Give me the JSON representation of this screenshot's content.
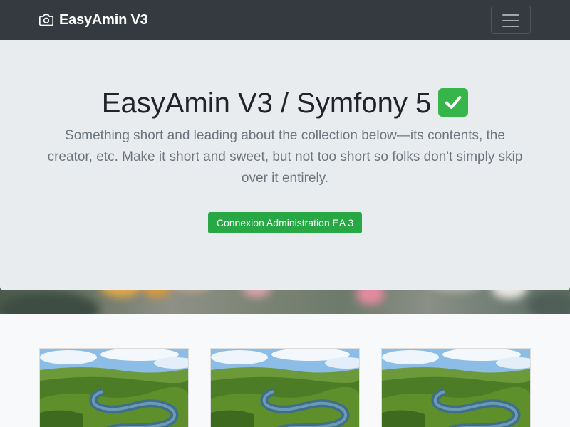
{
  "navbar": {
    "brand": "EasyAmin V3",
    "brand_icon": "camera-icon",
    "toggler_icon": "hamburger-menu-icon"
  },
  "hero": {
    "title": "EasyAmin V3 / Symfony 5",
    "title_emoji_icon": "check-mark-button-icon",
    "lead": "Something short and leading about the collection below—its contents, the creator, etc. Make it short and sweet, but not too short so folks don't simply skip over it entirely.",
    "cta_label": "Connexion Administration EA 3"
  },
  "album": {
    "cards": [
      {
        "image": "river-valley-thumbnail"
      },
      {
        "image": "river-valley-thumbnail"
      },
      {
        "image": "river-valley-thumbnail"
      }
    ]
  },
  "colors": {
    "navbar_bg": "#343a40",
    "jumbotron_bg": "#e9ecef",
    "cta_green": "#28a745",
    "lead_text": "#6c757d"
  }
}
